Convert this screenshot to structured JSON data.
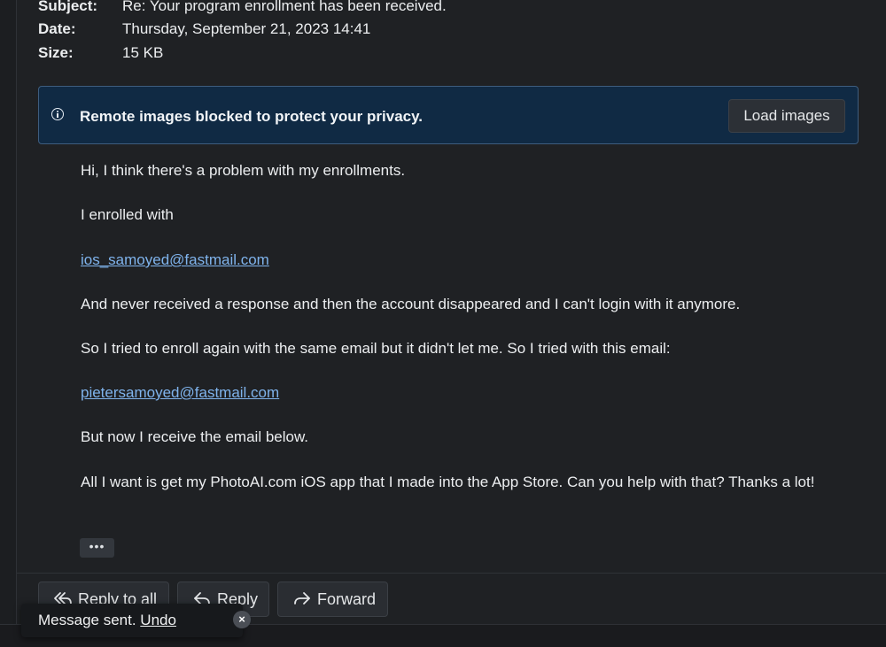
{
  "header": {
    "subject_label": "Subject:",
    "subject_value": "Re: Your program enrollment has been received.",
    "date_label": "Date:",
    "date_value": "Thursday, September 21, 2023 14:41",
    "size_label": "Size:",
    "size_value": "15 KB"
  },
  "banner": {
    "icon": "info-icon",
    "text": "Remote images blocked to protect your privacy.",
    "load_label": "Load images"
  },
  "message": {
    "p1": "Hi, I think there's a problem with my enrollments.",
    "p2": "I enrolled with",
    "link1": "ios_samoyed@fastmail.com",
    "p3": "And never received a response and then the account disappeared and I can't login with it anymore.",
    "p4": "So I tried to enroll again with the same email but it didn't let me. So I tried with this email:",
    "link2": "pietersamoyed@fastmail.com",
    "p5": "But now I receive the email below.",
    "p6": "All I want is get my PhotoAI.com iOS app that I made into the App Store. Can you help with that? Thanks a lot!",
    "more_label": "•••"
  },
  "actions": {
    "reply_all_label": "Reply to all",
    "reply_label": "Reply",
    "forward_label": "Forward"
  },
  "toast": {
    "text": "Message sent.",
    "undo_label": "Undo",
    "close_label": "×"
  },
  "colors": {
    "background": "#1f2124",
    "banner": "#102a44",
    "link": "#7fb3ec"
  }
}
